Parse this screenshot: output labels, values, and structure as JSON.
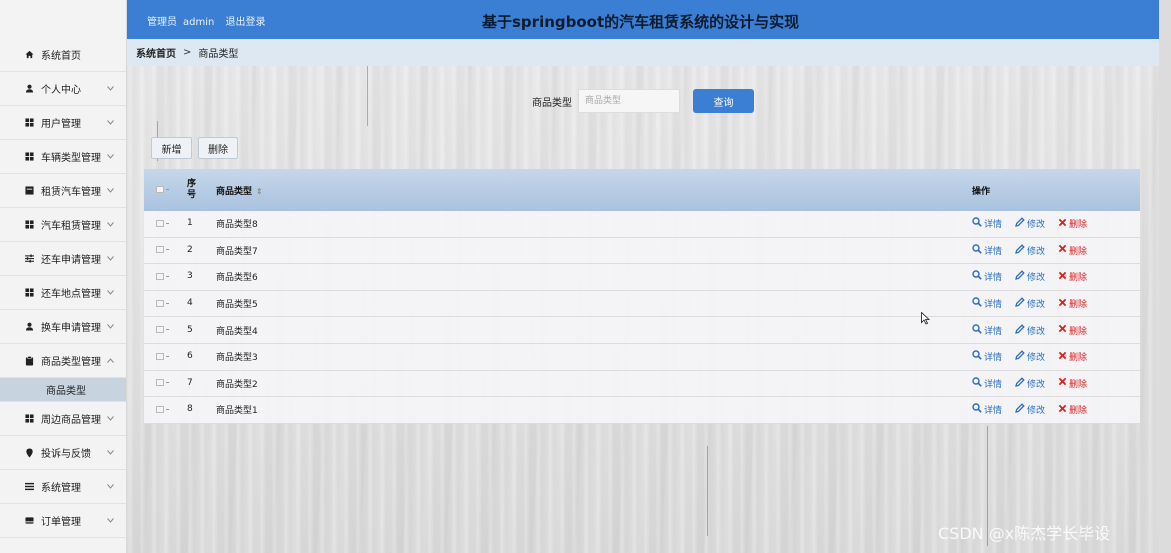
{
  "header": {
    "user_role": "管理员",
    "user_name": "admin",
    "logout_label": "退出登录",
    "title": "基于springboot的汽车租赁系统的设计与实现",
    "bg_color": "#3b7fd4"
  },
  "sidebar": {
    "items": [
      {
        "label": "系统首页",
        "icon": "home-icon"
      },
      {
        "label": "个人中心",
        "icon": "user-icon"
      },
      {
        "label": "用户管理",
        "icon": "grid-icon"
      },
      {
        "label": "车辆类型管理",
        "icon": "grid-icon"
      },
      {
        "label": "租赁汽车管理",
        "icon": "square-icon"
      },
      {
        "label": "汽车租赁管理",
        "icon": "grid-icon"
      },
      {
        "label": "还车申请管理",
        "icon": "sliders-icon"
      },
      {
        "label": "还车地点管理",
        "icon": "grid-icon"
      },
      {
        "label": "换车申请管理",
        "icon": "user-icon"
      },
      {
        "label": "商品类型管理",
        "icon": "clipboard-icon"
      },
      {
        "label": "周边商品管理",
        "icon": "grid-icon"
      },
      {
        "label": "投诉与反馈",
        "icon": "pin-icon"
      },
      {
        "label": "系统管理",
        "icon": "menu-icon"
      },
      {
        "label": "订单管理",
        "icon": "card-icon"
      }
    ],
    "sub_item": "商品类型"
  },
  "breadcrumb": {
    "home": "系统首页",
    "separator": ">",
    "current": "商品类型"
  },
  "search": {
    "label": "商品类型",
    "placeholder": "商品类型",
    "button": "查询"
  },
  "actions": {
    "add": "新增",
    "delete": "删除"
  },
  "table": {
    "headers": {
      "index_line1": "序",
      "index_line2": "号",
      "name": "商品类型",
      "ops": "操作"
    },
    "rows": [
      {
        "idx": "1",
        "name": "商品类型8"
      },
      {
        "idx": "2",
        "name": "商品类型7"
      },
      {
        "idx": "3",
        "name": "商品类型6"
      },
      {
        "idx": "4",
        "name": "商品类型5"
      },
      {
        "idx": "5",
        "name": "商品类型4"
      },
      {
        "idx": "6",
        "name": "商品类型3"
      },
      {
        "idx": "7",
        "name": "商品类型2"
      },
      {
        "idx": "8",
        "name": "商品类型1"
      }
    ],
    "op_labels": {
      "detail": "详情",
      "edit": "修改",
      "delete": "删除"
    }
  },
  "watermark": "CSDN @x陈杰学长毕设"
}
